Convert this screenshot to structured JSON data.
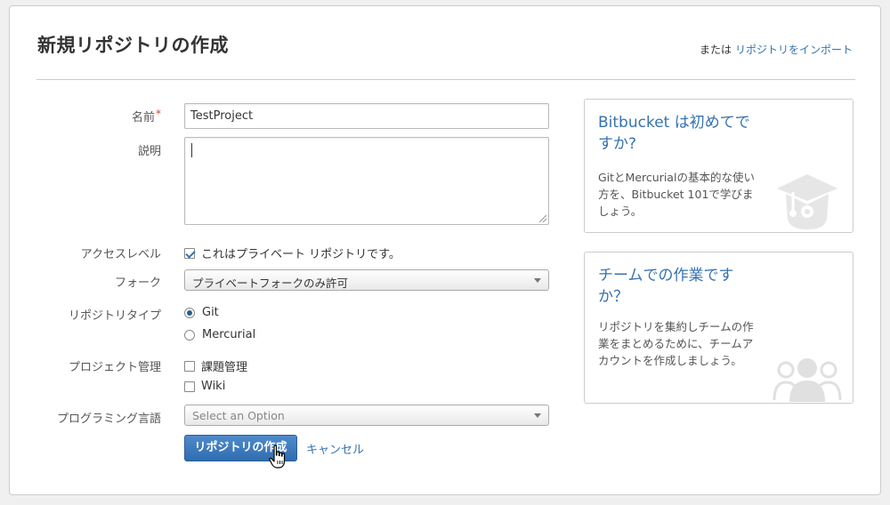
{
  "header": {
    "title": "新規リポジトリの作成",
    "import_prefix": "または",
    "import_link": "リポジトリをインポート"
  },
  "form": {
    "name": {
      "label": "名前",
      "required_mark": "*",
      "value": "TestProject"
    },
    "description": {
      "label": "説明",
      "value": ""
    },
    "access": {
      "label": "アクセスレベル",
      "checkbox_label": "これはプライベート リポジトリです。",
      "checked": true
    },
    "fork": {
      "label": "フォーク",
      "selected": "プライベートフォークのみ許可"
    },
    "repo_type": {
      "label": "リポジトリタイプ",
      "options": [
        {
          "label": "Git",
          "checked": true
        },
        {
          "label": "Mercurial",
          "checked": false
        }
      ]
    },
    "project_mgmt": {
      "label": "プロジェクト管理",
      "options": [
        {
          "label": "課題管理",
          "checked": false
        },
        {
          "label": "Wiki",
          "checked": false
        }
      ]
    },
    "language": {
      "label": "プログラミング言語",
      "placeholder": "Select an Option"
    },
    "submit_label": "リポジトリの作成",
    "cancel_label": "キャンセル"
  },
  "sidebar": {
    "card1": {
      "title": "Bitbucket は初めてですか?",
      "text": "GitとMercurialの基本的な使い方を、Bitbucket 101で学びましょう。",
      "icon": "graduation-cap-icon"
    },
    "card2": {
      "title": "チームでの作業ですか？",
      "text": "リポジトリを集約しチームの作業をまとめるために、チームアカウントを作成しましょう。",
      "icon": "team-icon"
    }
  },
  "colors": {
    "link": "#3572b0",
    "primary_button": "#3572b0",
    "required": "#d04437"
  }
}
